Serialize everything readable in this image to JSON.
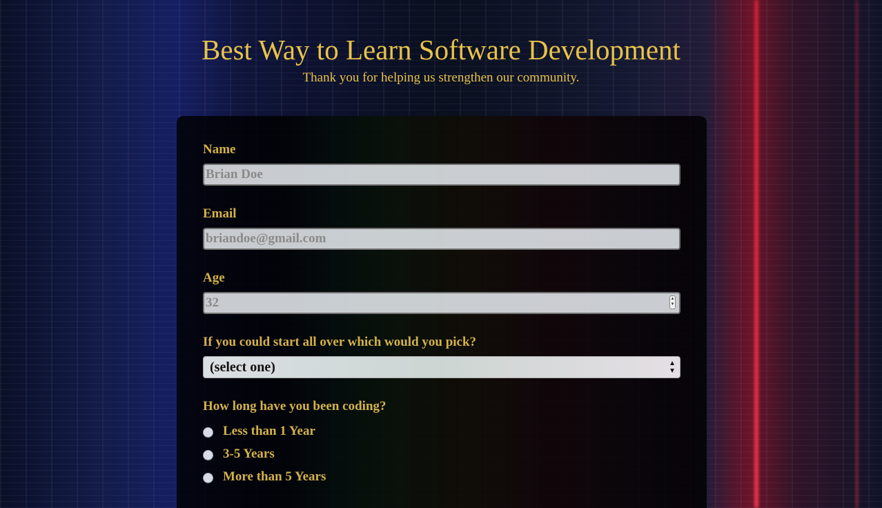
{
  "header": {
    "title": "Best Way to Learn Software Development",
    "subtitle": "Thank you for helping us strengthen our community."
  },
  "form": {
    "name": {
      "label": "Name",
      "placeholder": "Brian Doe"
    },
    "email": {
      "label": "Email",
      "placeholder": "briandoe@gmail.com"
    },
    "age": {
      "label": "Age",
      "placeholder": "32"
    },
    "start_over": {
      "label": "If you could start all over which would you pick?",
      "selected": "(select one)"
    },
    "coding_duration": {
      "label": "How long have you been coding?",
      "options": [
        "Less than 1 Year",
        "3-5 Years",
        "More than 5 Years"
      ]
    }
  },
  "colors": {
    "accent": "#e8c24a",
    "label": "#d4b24a",
    "card_bg": "#000000"
  }
}
